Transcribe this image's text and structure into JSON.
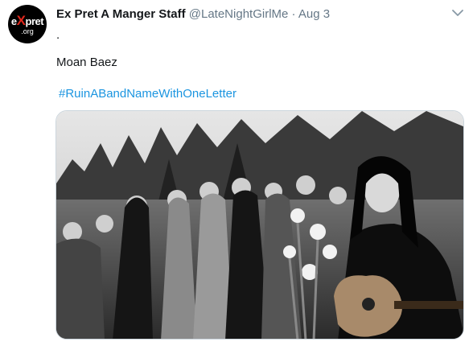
{
  "tweet": {
    "avatar": {
      "line1_a": "e",
      "line1_x": "X",
      "line1_b": "pret",
      "line2": ".org"
    },
    "author_name": "Ex Pret A Manger Staff",
    "handle": "@LateNightGirlMe",
    "separator": "·",
    "date": "Aug 3",
    "text_line1": ".",
    "text_line2": "Moan Baez",
    "hashtag": "#RuinABandNameWithOneLetter",
    "menu_icon": "chevron-down-icon",
    "media_description": "black-and-white photo of a folk singer with guitar performing at microphones before a crowd"
  }
}
